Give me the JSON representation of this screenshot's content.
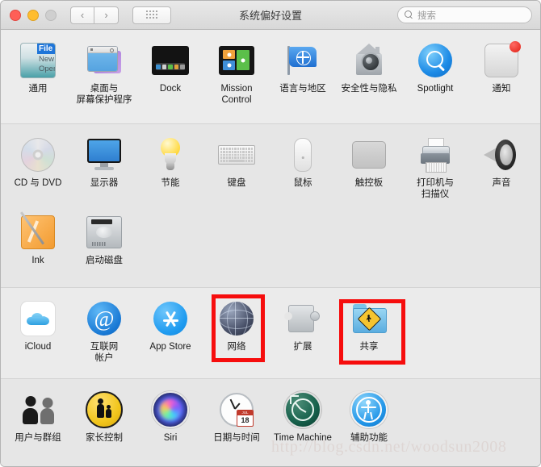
{
  "window": {
    "title": "系统偏好设置",
    "traffic": {
      "close": "close",
      "minimize": "minimize",
      "zoom": "zoom"
    },
    "nav": {
      "back": "‹",
      "forward": "›"
    },
    "grid_button": "show-all-grid"
  },
  "search": {
    "placeholder": "搜索"
  },
  "sections": [
    {
      "id": "personal",
      "rows": [
        [
          {
            "label": "通用",
            "icon": "general-icon"
          },
          {
            "label": "桌面与\n屏幕保护程序",
            "icon": "desktop-screensaver-icon"
          },
          {
            "label": "Dock",
            "icon": "dock-icon"
          },
          {
            "label": "Mission\nControl",
            "icon": "mission-control-icon"
          },
          {
            "label": "语言与地区",
            "icon": "language-region-icon"
          },
          {
            "label": "安全性与隐私",
            "icon": "security-privacy-icon"
          },
          {
            "label": "Spotlight",
            "icon": "spotlight-icon"
          },
          {
            "label": "通知",
            "icon": "notifications-icon"
          }
        ]
      ]
    },
    {
      "id": "hardware",
      "rows": [
        [
          {
            "label": "CD 与 DVD",
            "icon": "cd-dvd-icon"
          },
          {
            "label": "显示器",
            "icon": "displays-icon"
          },
          {
            "label": "节能",
            "icon": "energy-saver-icon"
          },
          {
            "label": "键盘",
            "icon": "keyboard-icon"
          },
          {
            "label": "鼠标",
            "icon": "mouse-icon"
          },
          {
            "label": "触控板",
            "icon": "trackpad-icon"
          },
          {
            "label": "打印机与\n扫描仪",
            "icon": "printers-scanners-icon"
          },
          {
            "label": "声音",
            "icon": "sound-icon"
          }
        ],
        [
          {
            "label": "Ink",
            "icon": "ink-icon"
          },
          {
            "label": "启动磁盘",
            "icon": "startup-disk-icon"
          }
        ]
      ]
    },
    {
      "id": "internet-wireless",
      "rows": [
        [
          {
            "label": "iCloud",
            "icon": "icloud-icon"
          },
          {
            "label": "互联网\n帐户",
            "icon": "internet-accounts-icon"
          },
          {
            "label": "App Store",
            "icon": "app-store-icon"
          },
          {
            "label": "网络",
            "icon": "network-icon",
            "highlighted": true
          },
          {
            "label": "扩展",
            "icon": "extensions-icon"
          },
          {
            "label": "共享",
            "icon": "sharing-icon",
            "highlighted": true
          }
        ]
      ]
    },
    {
      "id": "system",
      "rows": [
        [
          {
            "label": "用户与群组",
            "icon": "users-groups-icon"
          },
          {
            "label": "家长控制",
            "icon": "parental-controls-icon"
          },
          {
            "label": "Siri",
            "icon": "siri-icon"
          },
          {
            "label": "日期与时间",
            "icon": "date-time-icon"
          },
          {
            "label": "Time Machine",
            "icon": "time-machine-icon"
          },
          {
            "label": "辅助功能",
            "icon": "accessibility-icon"
          }
        ]
      ]
    }
  ],
  "annotations": {
    "highlight_color": "#f60d0d",
    "highlighted_items": [
      "网络",
      "共享"
    ]
  },
  "watermark": {
    "text": "http://blog.csdn.net/woodsun2008"
  },
  "calendar_icon": {
    "month": "JUL",
    "day": "18"
  },
  "general_icon_menu": {
    "line1": "File",
    "line2": "New",
    "line3": "Open"
  }
}
